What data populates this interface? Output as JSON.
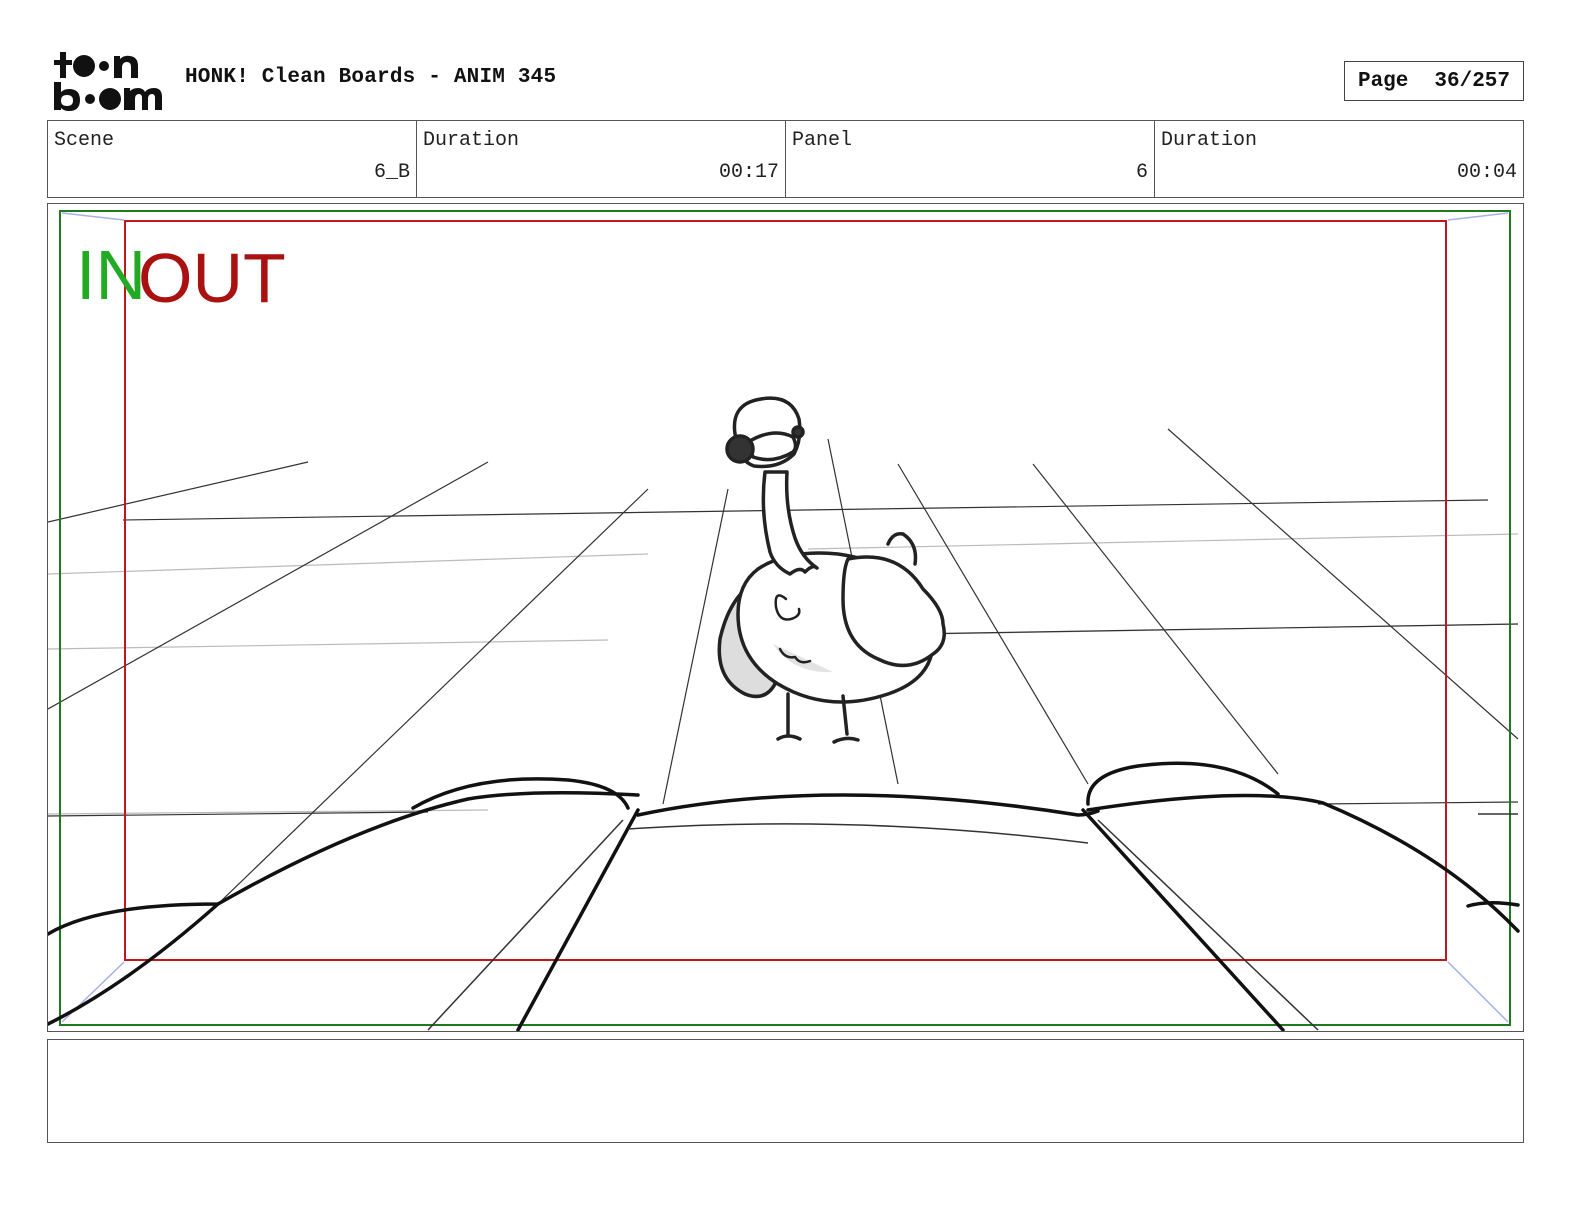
{
  "header": {
    "logo_text": "toon boom",
    "title": "HONK! Clean Boards - ANIM 345",
    "page_label": "Page",
    "page_value": "36/257"
  },
  "info": [
    {
      "label": "Scene",
      "value": "6_B"
    },
    {
      "label": "Duration",
      "value": "00:17"
    },
    {
      "label": "Panel",
      "value": "6"
    },
    {
      "label": "Duration",
      "value": "00:04"
    }
  ],
  "panel": {
    "in_label": "IN",
    "out_label": "OUT",
    "colors": {
      "in_frame": "#1e7a1e",
      "out_frame": "#c0181c",
      "in_text": "#22aa22",
      "out_text": "#aa1111"
    }
  },
  "notes": {
    "text": ""
  }
}
